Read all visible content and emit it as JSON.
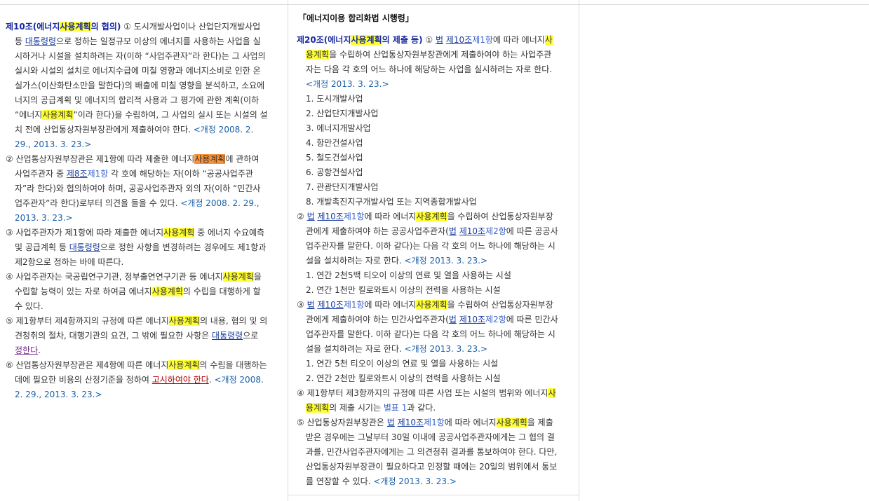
{
  "left_column": {
    "paragraphs": [
      [
        {
          "t": "제10조(에너지",
          "c": "art"
        },
        {
          "t": "사용계획",
          "c": "art hl"
        },
        {
          "t": "의 협의)",
          "c": "art"
        },
        {
          "t": " ① 도시개발사업이나 산업단지개발사업 등 "
        },
        {
          "t": "대통령령",
          "c": "lnk"
        },
        {
          "t": "으로 정하는 일정규모 이상의 에너지를 사용하는 사업을 실시하거나 시설을 설치하려는 자(이하 “사업주관자”라 한다)는 그 사업의 실시와 시설의 설치로 에너지수급에 미칠 영향과 에너지소비로 인한 온실가스(이산화탄소만을 말한다)의 배출에 미칠 영향을 분석하고, 소요에너지의 공급계획 및 에너지의 합리적 사용과 그 평가에 관한 계획(이하 “에너지"
        },
        {
          "t": "사용계획",
          "c": "hl"
        },
        {
          "t": "”이라 한다)을 수립하여, 그 사업의 실시 또는 시설의 설치 전에 산업통상자원부장관에게 제출하여야 한다. "
        },
        {
          "t": "<개정 2008. 2. 29., 2013. 3. 23.>",
          "c": "rev"
        }
      ],
      [
        {
          "t": "② 산업통상자원부장관은 제1항에 따라 제출한 에너지"
        },
        {
          "t": "사용계획",
          "c": "hlo"
        },
        {
          "t": "에 관하여 사업주관자 중 "
        },
        {
          "t": "제8조",
          "c": "lnk"
        },
        {
          "t": "제1항",
          "c": "lnk2"
        },
        {
          "t": " 각 호에 해당하는 자(이하 “공공사업주관자”라 한다)와 협의하여야 하며, 공공사업주관자 외의 자(이하 “민간사업주관자”라 한다)로부터 의견을 들을 수 있다. "
        },
        {
          "t": "<개정 2008. 2. 29., 2013. 3. 23.>",
          "c": "rev"
        }
      ],
      [
        {
          "t": "③ 사업주관자가 제1항에 따라 제출한 에너지"
        },
        {
          "t": "사용계획",
          "c": "hl"
        },
        {
          "t": " 중 에너지 수요예측 및 공급계획 등 "
        },
        {
          "t": "대통령령",
          "c": "lnk"
        },
        {
          "t": "으로 정한 사항을 변경하려는 경우에도 제1항과 제2항으로 정하는 바에 따른다."
        }
      ],
      [
        {
          "t": "④ 사업주관자는 국공립연구기관, 정부출연연구기관 등 에너지"
        },
        {
          "t": "사용계획",
          "c": "hl"
        },
        {
          "t": "을 수립할 능력이 있는 자로 하여금 에너지"
        },
        {
          "t": "사용계획",
          "c": "hl"
        },
        {
          "t": "의 수립을 대행하게 할 수 있다."
        }
      ],
      [
        {
          "t": "⑤ 제1항부터 제4항까지의 규정에 따른 에너지"
        },
        {
          "t": "사용계획",
          "c": "hl"
        },
        {
          "t": "의 내용, 협의 및 의견청취의 절차, 대행기관의 요건, 그 밖에 필요한 사항은 "
        },
        {
          "t": "대통령령",
          "c": "lnk"
        },
        {
          "t": "으로 "
        },
        {
          "t": "정한다",
          "c": "lnkp"
        },
        {
          "t": "."
        }
      ],
      [
        {
          "t": "⑥ 산업통상자원부장관은 제4항에 따른 에너지"
        },
        {
          "t": "사용계획",
          "c": "hl"
        },
        {
          "t": "의 수립을 대행하는 데에 필요한 비용의 산정기준을 정하여 "
        },
        {
          "t": "고시하여야 한다",
          "c": "lnkr"
        },
        {
          "t": ". "
        },
        {
          "t": "<개정 2008. 2. 29., 2013. 3. 23.>",
          "c": "rev"
        }
      ]
    ]
  },
  "middle_column": {
    "title": "「에너지이용 합리화법 시행령」",
    "paragraphs": [
      {
        "kind": "hang",
        "runs": [
          {
            "t": "제20조(에너지",
            "c": "art"
          },
          {
            "t": "사용계획",
            "c": "art hl"
          },
          {
            "t": "의 제출 등)",
            "c": "art"
          },
          {
            "t": " ① "
          },
          {
            "t": "법",
            "c": "lnk"
          },
          {
            "t": " "
          },
          {
            "t": "제10조",
            "c": "lnk"
          },
          {
            "t": "제1항",
            "c": "lnk2"
          },
          {
            "t": "에 따라 에너지"
          },
          {
            "t": "사용계획",
            "c": "hl"
          },
          {
            "t": "을 수립하여 산업통상자원부장관에게 제출하여야 하는 사업주관자는 다음 각 호의 어느 하나에 해당하는 사업을 실시하려는 자로 한다. "
          },
          {
            "t": "<개정 2013. 3. 23.>",
            "c": "rev"
          }
        ]
      },
      {
        "kind": "item",
        "runs": [
          {
            "t": "1. 도시개발사업"
          }
        ]
      },
      {
        "kind": "item",
        "runs": [
          {
            "t": "2. 산업단지개발사업"
          }
        ]
      },
      {
        "kind": "item",
        "runs": [
          {
            "t": "3. 에너지개발사업"
          }
        ]
      },
      {
        "kind": "item",
        "runs": [
          {
            "t": "4. 항만건설사업"
          }
        ]
      },
      {
        "kind": "item",
        "runs": [
          {
            "t": "5. 철도건설사업"
          }
        ]
      },
      {
        "kind": "item",
        "runs": [
          {
            "t": "6. 공항건설사업"
          }
        ]
      },
      {
        "kind": "item",
        "runs": [
          {
            "t": "7. 관광단지개발사업"
          }
        ]
      },
      {
        "kind": "item",
        "runs": [
          {
            "t": "8. 개발촉진지구개발사업 또는 지역종합개발사업"
          }
        ]
      },
      {
        "kind": "hang",
        "runs": [
          {
            "t": "② "
          },
          {
            "t": "법",
            "c": "lnk"
          },
          {
            "t": " "
          },
          {
            "t": "제10조",
            "c": "lnk"
          },
          {
            "t": "제1항",
            "c": "lnk2"
          },
          {
            "t": "에 따라 에너지"
          },
          {
            "t": "사용계획",
            "c": "hl"
          },
          {
            "t": "을 수립하여 산업통상자원부장관에게 제출하여야 하는 공공사업주관자("
          },
          {
            "t": "법",
            "c": "lnk"
          },
          {
            "t": " "
          },
          {
            "t": "제10조",
            "c": "lnk"
          },
          {
            "t": "제2항",
            "c": "lnk2"
          },
          {
            "t": "에 따른 공공사업주관자를 말한다. 이하 같다)는 다음 각 호의 어느 하나에 해당하는 시설을 설치하려는 자로 한다. "
          },
          {
            "t": "<개정 2013. 3. 23.>",
            "c": "rev"
          }
        ]
      },
      {
        "kind": "item",
        "runs": [
          {
            "t": "1. 연간 2천5백 티오이 이상의 연료 및 열을 사용하는 시설"
          }
        ]
      },
      {
        "kind": "item",
        "runs": [
          {
            "t": "2. 연간 1천만 킬로와트시 이상의 전력을 사용하는 시설"
          }
        ]
      },
      {
        "kind": "hang",
        "runs": [
          {
            "t": "③ "
          },
          {
            "t": "법",
            "c": "lnk"
          },
          {
            "t": " "
          },
          {
            "t": "제10조",
            "c": "lnk"
          },
          {
            "t": "제1항",
            "c": "lnk2"
          },
          {
            "t": "에 따라 에너지"
          },
          {
            "t": "사용계획",
            "c": "hl"
          },
          {
            "t": "을 수립하여 산업통상자원부장관에게 제출하여야 하는 민간사업주관자("
          },
          {
            "t": "법",
            "c": "lnk"
          },
          {
            "t": " "
          },
          {
            "t": "제10조",
            "c": "lnk"
          },
          {
            "t": "제2항",
            "c": "lnk2"
          },
          {
            "t": "에 따른 민간사업주관자를 말한다. 이하 같다)는 다음 각 호의 어느 하나에 해당하는 시설을 설치하려는 자로 한다. "
          },
          {
            "t": "<개정 2013. 3. 23.>",
            "c": "rev"
          }
        ]
      },
      {
        "kind": "item",
        "runs": [
          {
            "t": "1. 연간 5천 티오이 이상의 연료 및 열을 사용하는 시설"
          }
        ]
      },
      {
        "kind": "item",
        "runs": [
          {
            "t": "2. 연간 2천만 킬로와트시 이상의 전력을 사용하는 시설"
          }
        ]
      },
      {
        "kind": "hang",
        "runs": [
          {
            "t": "④ 제1항부터 제3항까지의 규정에 따른 사업 또는 시설의 범위와 에너지"
          },
          {
            "t": "사용계획",
            "c": "hl"
          },
          {
            "t": "의 제출 시기는 "
          },
          {
            "t": "별표 1",
            "c": "lnk2"
          },
          {
            "t": "과 같다."
          }
        ]
      },
      {
        "kind": "hang",
        "runs": [
          {
            "t": "⑤ 산업통상자원부장관은 "
          },
          {
            "t": "법",
            "c": "lnk"
          },
          {
            "t": " "
          },
          {
            "t": "제10조",
            "c": "lnk"
          },
          {
            "t": "제1항",
            "c": "lnk2"
          },
          {
            "t": "에 따라 에너지"
          },
          {
            "t": "사용계획",
            "c": "hl"
          },
          {
            "t": "을 제출받은 경우에는 그날부터 30일 이내에 공공사업주관자에게는 그 협의 결과를, 민간사업주관자에게는 그 의견청취 결과를 통보하여야 한다. 다만, 산업통상자원부장관이 필요하다고 인정할 때에는 20일의 범위에서 통보를 연장할 수 있다. "
          },
          {
            "t": "<개정 2013. 3. 23.>",
            "c": "rev"
          }
        ]
      }
    ]
  }
}
